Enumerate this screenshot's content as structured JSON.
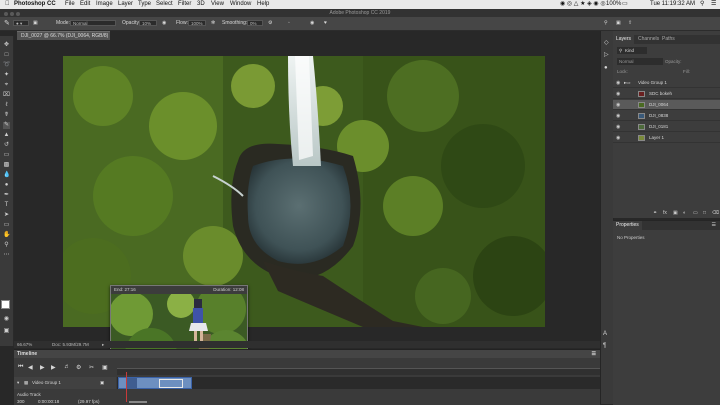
{
  "menubar": {
    "app": "Photoshop CC",
    "items": [
      "File",
      "Edit",
      "Image",
      "Layer",
      "Type",
      "Select",
      "Filter",
      "3D",
      "View",
      "Window",
      "Help"
    ],
    "battery": "100%",
    "clock": "Tue 11:19:32 AM"
  },
  "window": {
    "title": "Adobe Photoshop CC 2019"
  },
  "options": {
    "mode_label": "Mode:",
    "mode_value": "Normal",
    "opacity_label": "Opacity:",
    "opacity_value": "10%",
    "flow_label": "Flow:",
    "flow_value": "100%",
    "smoothing_label": "Smoothing:",
    "smoothing_value": "0%"
  },
  "document": {
    "tab_label": "DJI_0027 @ 66.7% (DJI_0064, RGB/8) *",
    "zoom": "66.67%",
    "doc_info": "Doc: 5.93M/29.7M"
  },
  "popup": {
    "end_label": "End: 27:16",
    "duration_label": "Duration: 12:08"
  },
  "timeline": {
    "title": "Timeline",
    "track_name": "Video Group 1",
    "audio_label": "Audio Track",
    "timecode": "0:00:00:18",
    "fps": "(29.97 fps)",
    "fps_prefix": "300"
  },
  "layers": {
    "tabs": [
      "Layers",
      "Channels",
      "Paths"
    ],
    "filter_label": "Kind",
    "blend_mode": "Normal",
    "opacity_label": "Opacity:",
    "lock_label": "Lock:",
    "fill_label": "Fill:",
    "rows": [
      {
        "name": "Video Group 1",
        "type": "group"
      },
      {
        "name": "SDC bokeh",
        "type": "video"
      },
      {
        "name": "DJI_0064",
        "type": "video",
        "selected": true
      },
      {
        "name": "DJI_0838",
        "type": "video"
      },
      {
        "name": "DJI_0181",
        "type": "video"
      },
      {
        "name": "Layer 1",
        "type": "layer"
      }
    ]
  },
  "properties": {
    "title": "Properties",
    "empty_text": "No Properties"
  },
  "colors": {
    "accent": "#4a7fd0",
    "clip_fill": "#6d8fc0"
  }
}
